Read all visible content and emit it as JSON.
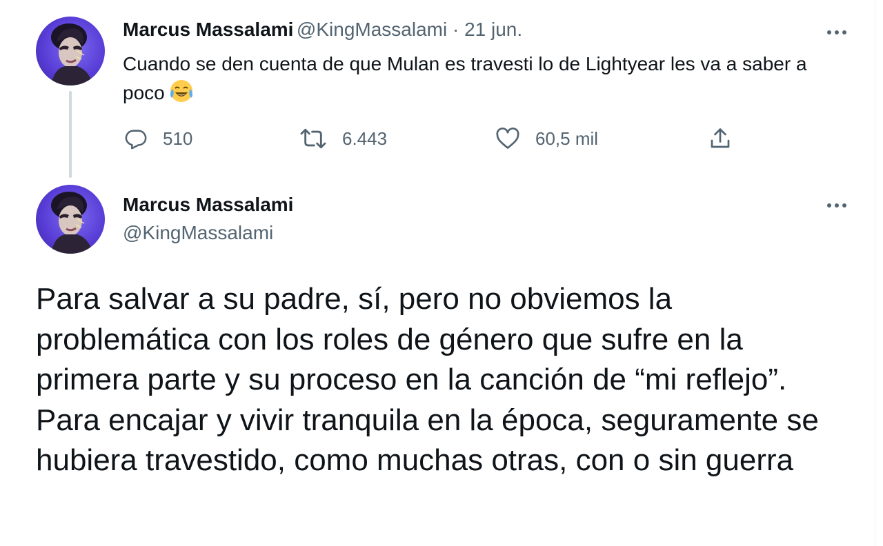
{
  "tweet1": {
    "name": "Marcus Massalami",
    "handle": "@KingMassalami",
    "separator": " · ",
    "date": "21 jun.",
    "text": "Cuando se den cuenta de que Mulan es travesti lo de Lightyear les va a saber a poco",
    "emoji": "face-with-tears-of-joy-icon",
    "replies": "510",
    "retweets": "6.443",
    "likes": "60,5 mil"
  },
  "tweet2": {
    "name": "Marcus Massalami",
    "handle": "@KingMassalami",
    "text": "Para salvar a su padre, sí, pero no obviemos la problemática con los roles de género que sufre en la primera parte y su proceso en la canción de “mi reflejo”. Para encajar y vivir tranquila en la época, seguramente se hubiera travestido, como muchas otras, con o sin guerra"
  },
  "icons": [
    "reply-icon",
    "retweet-icon",
    "like-icon",
    "share-icon",
    "more-options-icon"
  ],
  "colors": {
    "text": "#0f1419",
    "secondary": "#536471",
    "thread_line": "#cfd9de",
    "avatar_bg": "#5a3fd8"
  }
}
